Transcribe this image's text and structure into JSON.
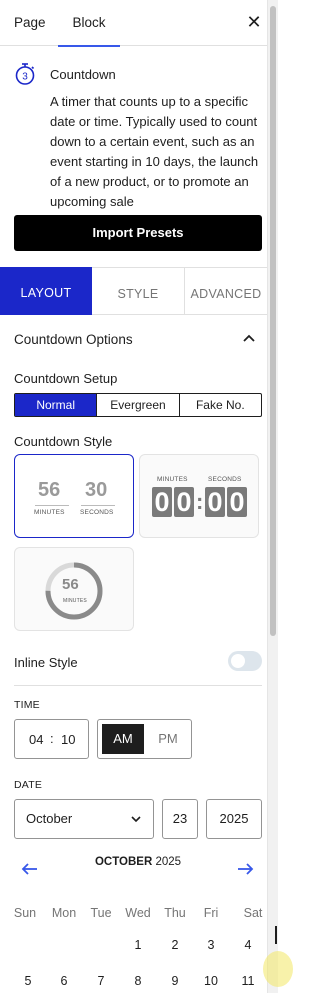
{
  "tabs": {
    "page": "Page",
    "block": "Block"
  },
  "block": {
    "name": "Countdown",
    "description": "A timer that counts up to a specific date or time. Typically used to count down to a certain event, such as an event starting in 10 days, the launch of a new product, or to promote an upcoming sale",
    "icon_label": "3",
    "import_label": "Import Presets"
  },
  "panel_tabs": {
    "layout": "LAYOUT",
    "style": "STYLE",
    "advanced": "ADVANCED"
  },
  "countdown_options": {
    "title": "Countdown Options"
  },
  "setup": {
    "label": "Countdown Setup",
    "options": [
      "Normal",
      "Evergreen",
      "Fake No."
    ],
    "selected": "Normal"
  },
  "style": {
    "label": "Countdown Style",
    "card1": {
      "minutes": "56",
      "seconds": "30",
      "minutes_label": "MINUTES",
      "seconds_label": "SECONDS"
    },
    "card2": {
      "minutes_label": "MINUTES",
      "seconds_label": "SECONDS",
      "d1": "0",
      "d2": "0",
      "d3": "0",
      "d4": "0",
      "colon": ":"
    },
    "card3": {
      "value": "56",
      "label": "MINUTES",
      "progress": 0.75
    }
  },
  "inline_style": {
    "label": "Inline Style",
    "on": false
  },
  "time": {
    "label": "TIME",
    "hours": "04",
    "sep": ":",
    "minutes": "10",
    "am": "AM",
    "pm": "PM",
    "selected": "AM"
  },
  "date": {
    "label": "DATE",
    "month": "October",
    "day": "23",
    "year": "2025"
  },
  "calendar": {
    "month_label": "OCTOBER",
    "year_label": "2025",
    "weekdays": [
      "Sun",
      "Mon",
      "Tue",
      "Wed",
      "Thu",
      "Fri",
      "Sat"
    ],
    "week1": [
      "1",
      "2",
      "3",
      "4"
    ],
    "week2": [
      "5",
      "6",
      "7",
      "8",
      "9",
      "10",
      "11"
    ]
  },
  "colors": {
    "accent": "#1b27c9",
    "wp_blue": "#3858e9",
    "dark": "#1e1e1e"
  }
}
